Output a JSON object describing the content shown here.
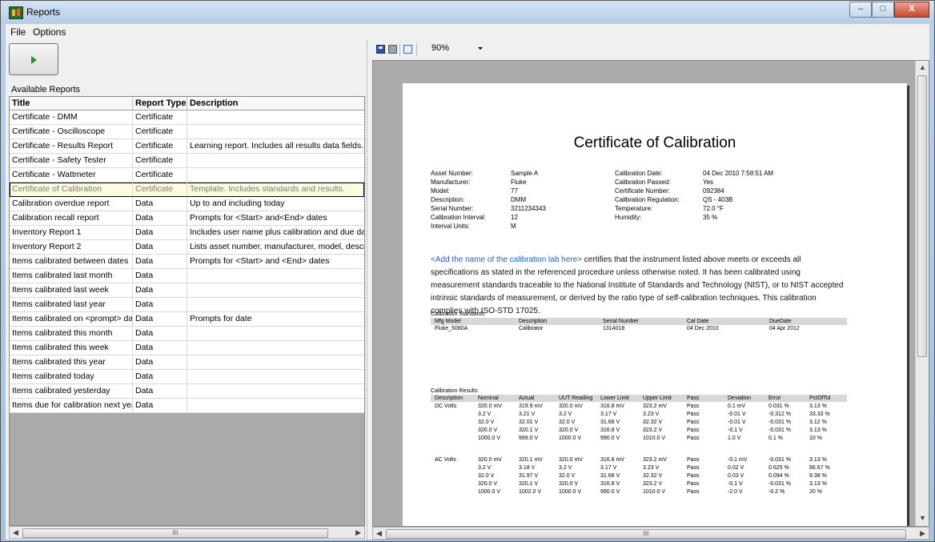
{
  "window": {
    "title": "Reports",
    "btn_min": "–",
    "btn_max": "□",
    "btn_close": "X"
  },
  "menu": {
    "file": "File",
    "options": "Options"
  },
  "left": {
    "available_label": "Available Reports",
    "columns": [
      "Title",
      "Report Type",
      "Description"
    ],
    "rows": [
      [
        "Certificate - DMM",
        "Certificate",
        ""
      ],
      [
        "Certificate - Oscilloscope",
        "Certificate",
        ""
      ],
      [
        "Certificate - Results Report",
        "Certificate",
        "Learning report. Includes all results data fields."
      ],
      [
        "Certificate - Safety Tester",
        "Certificate",
        ""
      ],
      [
        "Certificate - Wattmeter",
        "Certificate",
        ""
      ],
      [
        "Certificate of Calibration",
        "Certificate",
        "Template. Includes standards and results."
      ],
      [
        "Calibration overdue report",
        "Data",
        "Up to and including today"
      ],
      [
        "Calibration recall report",
        "Data",
        "Prompts for <Start> and<End> dates"
      ],
      [
        "Inventory Report 1",
        "Data",
        "Includes user name plus calibration and due dates"
      ],
      [
        "Inventory Report 2",
        "Data",
        "Lists asset number, manufacturer, model, descripti"
      ],
      [
        "Items calibrated between dates",
        "Data",
        "Prompts for <Start> and <End> dates"
      ],
      [
        "Items calibrated last month",
        "Data",
        ""
      ],
      [
        "Items calibrated last week",
        "Data",
        ""
      ],
      [
        "Items calibrated last year",
        "Data",
        ""
      ],
      [
        "Items calibrated on <prompt> date",
        "Data",
        "Prompts for date"
      ],
      [
        "Items calibrated this month",
        "Data",
        ""
      ],
      [
        "Items calibrated this week",
        "Data",
        ""
      ],
      [
        "Items calibrated this year",
        "Data",
        ""
      ],
      [
        "Items calibrated today",
        "Data",
        ""
      ],
      [
        "Items calibrated yesterday",
        "Data",
        ""
      ],
      [
        "Items due for calibration next year",
        "Data",
        ""
      ]
    ],
    "selected_index": 5,
    "scroll_mark": "III"
  },
  "viewer": {
    "zoom": "90%",
    "scroll_mark": "III",
    "certificate": {
      "title": "Certificate of Calibration",
      "left_fields": [
        [
          "Asset Number:",
          "Sample A"
        ],
        [
          "Manufacturer:",
          "Fluke"
        ],
        [
          "Model:",
          "77"
        ],
        [
          "Description:",
          "DMM"
        ],
        [
          "Serial Number:",
          "3211234343"
        ],
        [
          "Calibration Interval:",
          "12"
        ],
        [
          "Interval Units:",
          "M"
        ]
      ],
      "right_fields": [
        [
          "Calibration Date:",
          "04 Dec 2010 7:58:51 AM"
        ],
        [
          "Calibration Passed:",
          "Yes"
        ],
        [
          "Certificate Number:",
          "092384"
        ],
        [
          "Calibration Regulation:",
          "QS - 403B"
        ],
        [
          "Temperature:",
          "72.0 °F"
        ],
        [
          "Humidity:",
          "35 %"
        ]
      ],
      "lab_placeholder": "<Add the name of the calibration lab here>",
      "paragraph": " certifies that the instrument listed above meets or exceeds all specifications as stated in the referenced procedure unless otherwise noted. It has been calibrated using measurement standards traceable to the National Institute of Standards and Technology (NIST), or to NIST accepted intrinsic standards of measurement, or derived by the ratio type of self-calibration techniques. This calibration complies with ISO-STD 17025.",
      "standards_label": "Calibration Standards",
      "standards_headers": [
        "Mfg Model",
        "Description",
        "Serial Number",
        "Cal Date",
        "DueDate"
      ],
      "standards_row": [
        "Fluke_5080A",
        "Calibrator",
        "1314018",
        "04 Dec 2010",
        "04 Apr 2012"
      ],
      "results_label": "Calibration Results",
      "results_headers": [
        "Description",
        "Nominal",
        "Actual",
        "UUT Reading",
        "Lower Limit",
        "Upper Limit",
        "Pass",
        "Deviation",
        "Error",
        "PctOfTol"
      ],
      "results": [
        {
          "group": "DC Volts",
          "rows": [
            [
              "320.0 mV",
              "319.9 mV",
              "320.0 mV",
              "316.8 mV",
              "323.2 mV",
              "Pass",
              "0.1 mV",
              "0.031 %",
              "3.13 %"
            ],
            [
              "3.2 V",
              "3.21 V",
              "3.2 V",
              "3.17 V",
              "3.23 V",
              "Pass",
              "-0.01 V",
              "-0.312 %",
              "33.33 %"
            ],
            [
              "32.0 V",
              "32.01 V",
              "32.0 V",
              "31.68 V",
              "32.32 V",
              "Pass",
              "-0.01 V",
              "-0.031 %",
              "3.12 %"
            ],
            [
              "320.0 V",
              "320.1 V",
              "320.0 V",
              "316.8 V",
              "323.2 V",
              "Pass",
              "-0.1 V",
              "-0.031 %",
              "3.13 %"
            ],
            [
              "1000.0 V",
              "999.0 V",
              "1000.0 V",
              "990.0 V",
              "1010.0 V",
              "Pass",
              "1.0 V",
              "0.1 %",
              "10 %"
            ]
          ]
        },
        {
          "group": "AC Volts",
          "rows": [
            [
              "320.0 mV",
              "320.1 mV",
              "320.0 mV",
              "316.8 mV",
              "323.2 mV",
              "Pass",
              "-0.1 mV",
              "-0.031 %",
              "3.13 %"
            ],
            [
              "3.2 V",
              "3.18 V",
              "3.2 V",
              "3.17 V",
              "3.23 V",
              "Pass",
              "0.02 V",
              "0.625 %",
              "66.67 %"
            ],
            [
              "32.0 V",
              "31.97 V",
              "32.0 V",
              "31.68 V",
              "32.32 V",
              "Pass",
              "0.03 V",
              "0.094 %",
              "9.38 %"
            ],
            [
              "320.0 V",
              "320.1 V",
              "320.0 V",
              "316.8 V",
              "323.2 V",
              "Pass",
              "-0.1 V",
              "-0.031 %",
              "3.13 %"
            ],
            [
              "1000.0 V",
              "1002.0 V",
              "1000.0 V",
              "990.0 V",
              "1010.0 V",
              "Pass",
              "-2.0 V",
              "-0.2 %",
              "20 %"
            ]
          ]
        }
      ]
    }
  }
}
